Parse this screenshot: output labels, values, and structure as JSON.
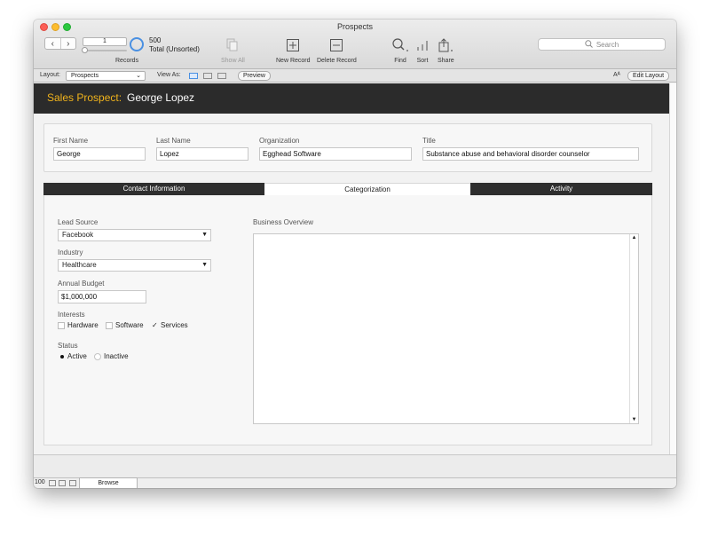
{
  "window": {
    "title": "Prospects"
  },
  "toolbar": {
    "current_record": "1",
    "found_count": "500",
    "total_label": "Total (Unsorted)",
    "records_label": "Records",
    "show_all_label": "Show All",
    "new_record_label": "New Record",
    "delete_record_label": "Delete Record",
    "find_label": "Find",
    "sort_label": "Sort",
    "share_label": "Share",
    "search_placeholder": "Search"
  },
  "layout_bar": {
    "layout_label": "Layout:",
    "layout_value": "Prospects",
    "view_as_label": "View As:",
    "preview_label": "Preview",
    "font_size_icon": "Aᴬ",
    "edit_layout_label": "Edit Layout"
  },
  "header": {
    "label": "Sales Prospect:",
    "name": "George Lopez"
  },
  "fields": {
    "first_name_label": "First Name",
    "first_name": "George",
    "last_name_label": "Last Name",
    "last_name": "Lopez",
    "organization_label": "Organization",
    "organization": "Egghead Software",
    "title_label": "Title",
    "title": "Substance abuse and behavioral disorder counselor"
  },
  "tabs": [
    {
      "label": "Contact Information",
      "selected": false
    },
    {
      "label": "Categorization",
      "selected": true
    },
    {
      "label": "Activity",
      "selected": false
    }
  ],
  "categorization": {
    "lead_source_label": "Lead Source",
    "lead_source": "Facebook",
    "industry_label": "Industry",
    "industry": "Healthcare",
    "annual_budget_label": "Annual Budget",
    "annual_budget": "$1,000,000",
    "interests_label": "Interests",
    "interests": [
      {
        "label": "Hardware",
        "checked": false
      },
      {
        "label": "Software",
        "checked": false
      },
      {
        "label": "Services",
        "checked": true
      }
    ],
    "status_label": "Status",
    "status": [
      {
        "label": "Active",
        "selected": true
      },
      {
        "label": "Inactive",
        "selected": false
      }
    ],
    "business_overview_label": "Business Overview",
    "business_overview": ""
  },
  "statusbar": {
    "zoom": "100",
    "mode": "Browse"
  },
  "colors": {
    "header_bg": "#2b2b2b",
    "header_label": "#f0b31c",
    "tab_dark": "#2e2e2e",
    "accent": "#4a90e2"
  },
  "icons": {
    "check": "✓",
    "dropdown_arrow": "▼",
    "scroll_up": "▲",
    "scroll_down": "▼",
    "nav_prev": "‹",
    "nav_next": "›",
    "layout_arrow": "⌄"
  }
}
